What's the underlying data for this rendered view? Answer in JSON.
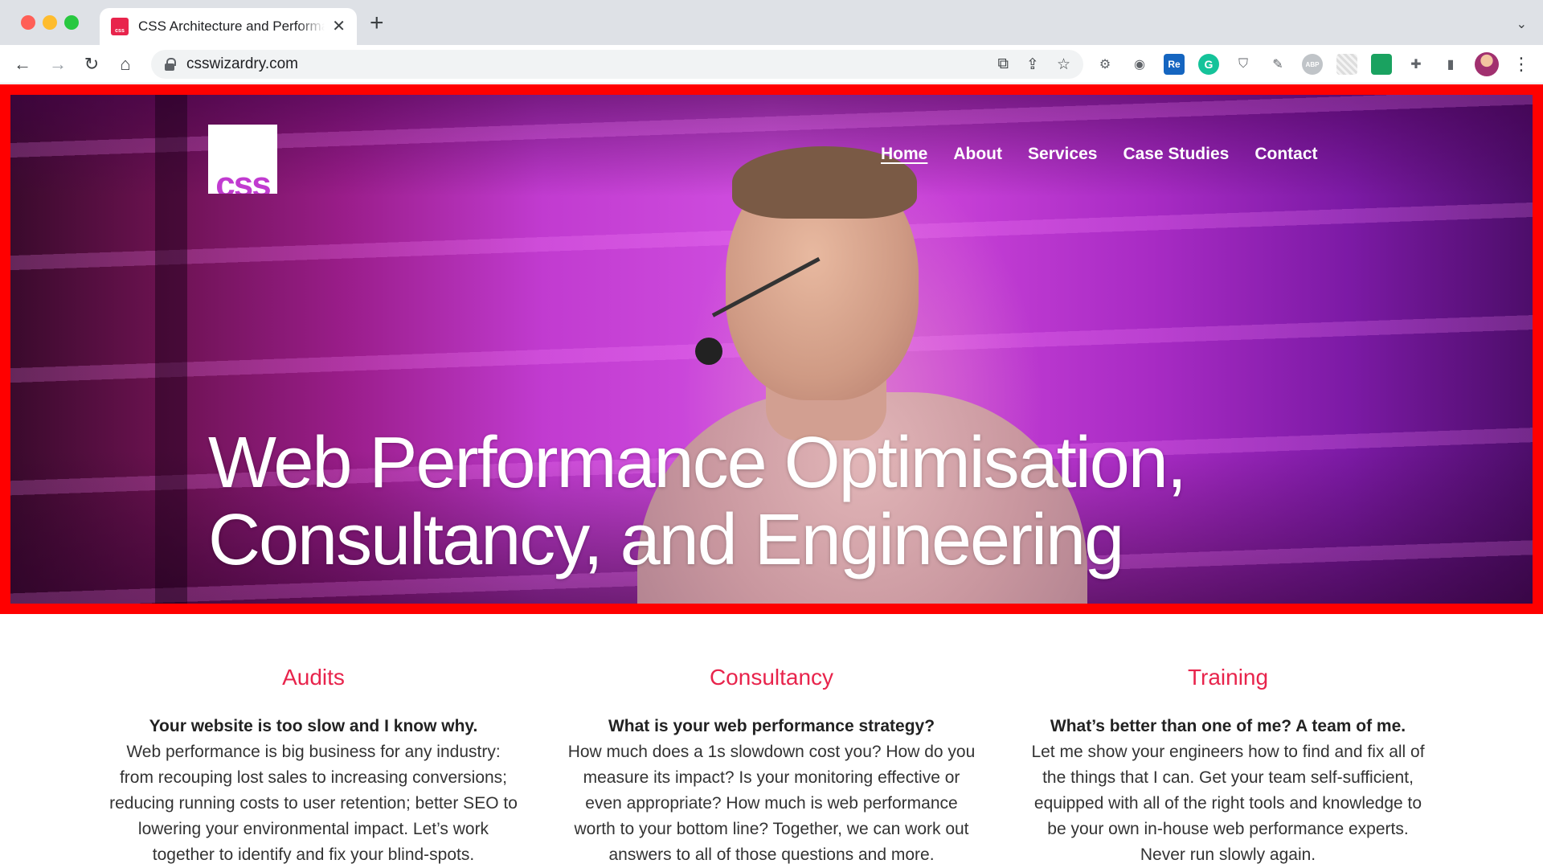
{
  "browser": {
    "tab_title": "CSS Architecture and Performance",
    "favicon_text": "css",
    "url": "csswizardry.com"
  },
  "site": {
    "logo_text": "css",
    "nav": [
      {
        "label": "Home",
        "active": true
      },
      {
        "label": "About",
        "active": false
      },
      {
        "label": "Services",
        "active": false
      },
      {
        "label": "Case Studies",
        "active": false
      },
      {
        "label": "Contact",
        "active": false
      }
    ],
    "hero_title_line1": "Web Performance Optimisation,",
    "hero_title_line2": "Consultancy, and Engineering",
    "accent_color": "#e8244c",
    "hero_border_color": "#ff0000"
  },
  "services": [
    {
      "title": "Audits",
      "lead": "Your website is too slow and I know why.",
      "body": "Web performance is big business for any industry: from recouping lost sales to increasing conversions; reducing running costs to user retention; better SEO to lowering your environmental impact. Let’s work together to identify and fix your blind-spots."
    },
    {
      "title": "Consultancy",
      "lead": "What is your web performance strategy?",
      "body": "How much does a 1s slowdown cost you? How do you measure its impact? Is your monitoring effective or even appropriate? How much is web performance worth to your bottom line? Together, we can work out answers to all of those questions and more."
    },
    {
      "title": "Training",
      "lead": "What’s better than one of me? A team of me.",
      "body": "Let me show your engineers how to find and fix all of the things that I can. Get your team self-sufficient, equipped with all of the right tools and knowledge to be your own in-house web performance experts. Never run slowly again."
    }
  ],
  "icons": {
    "back": "arrow-left-icon",
    "forward": "arrow-right-icon",
    "reload": "reload-icon",
    "home": "home-icon",
    "lock": "lock-icon",
    "open_external": "external-link-icon",
    "share": "share-icon",
    "bookmark": "star-icon",
    "extensions": "puzzle-icon",
    "side_panel": "side-panel-icon",
    "menu": "kebab-menu-icon"
  },
  "extensions_labels": {
    "readly": "Re",
    "grammarly": "G",
    "adblock": "ABP"
  }
}
